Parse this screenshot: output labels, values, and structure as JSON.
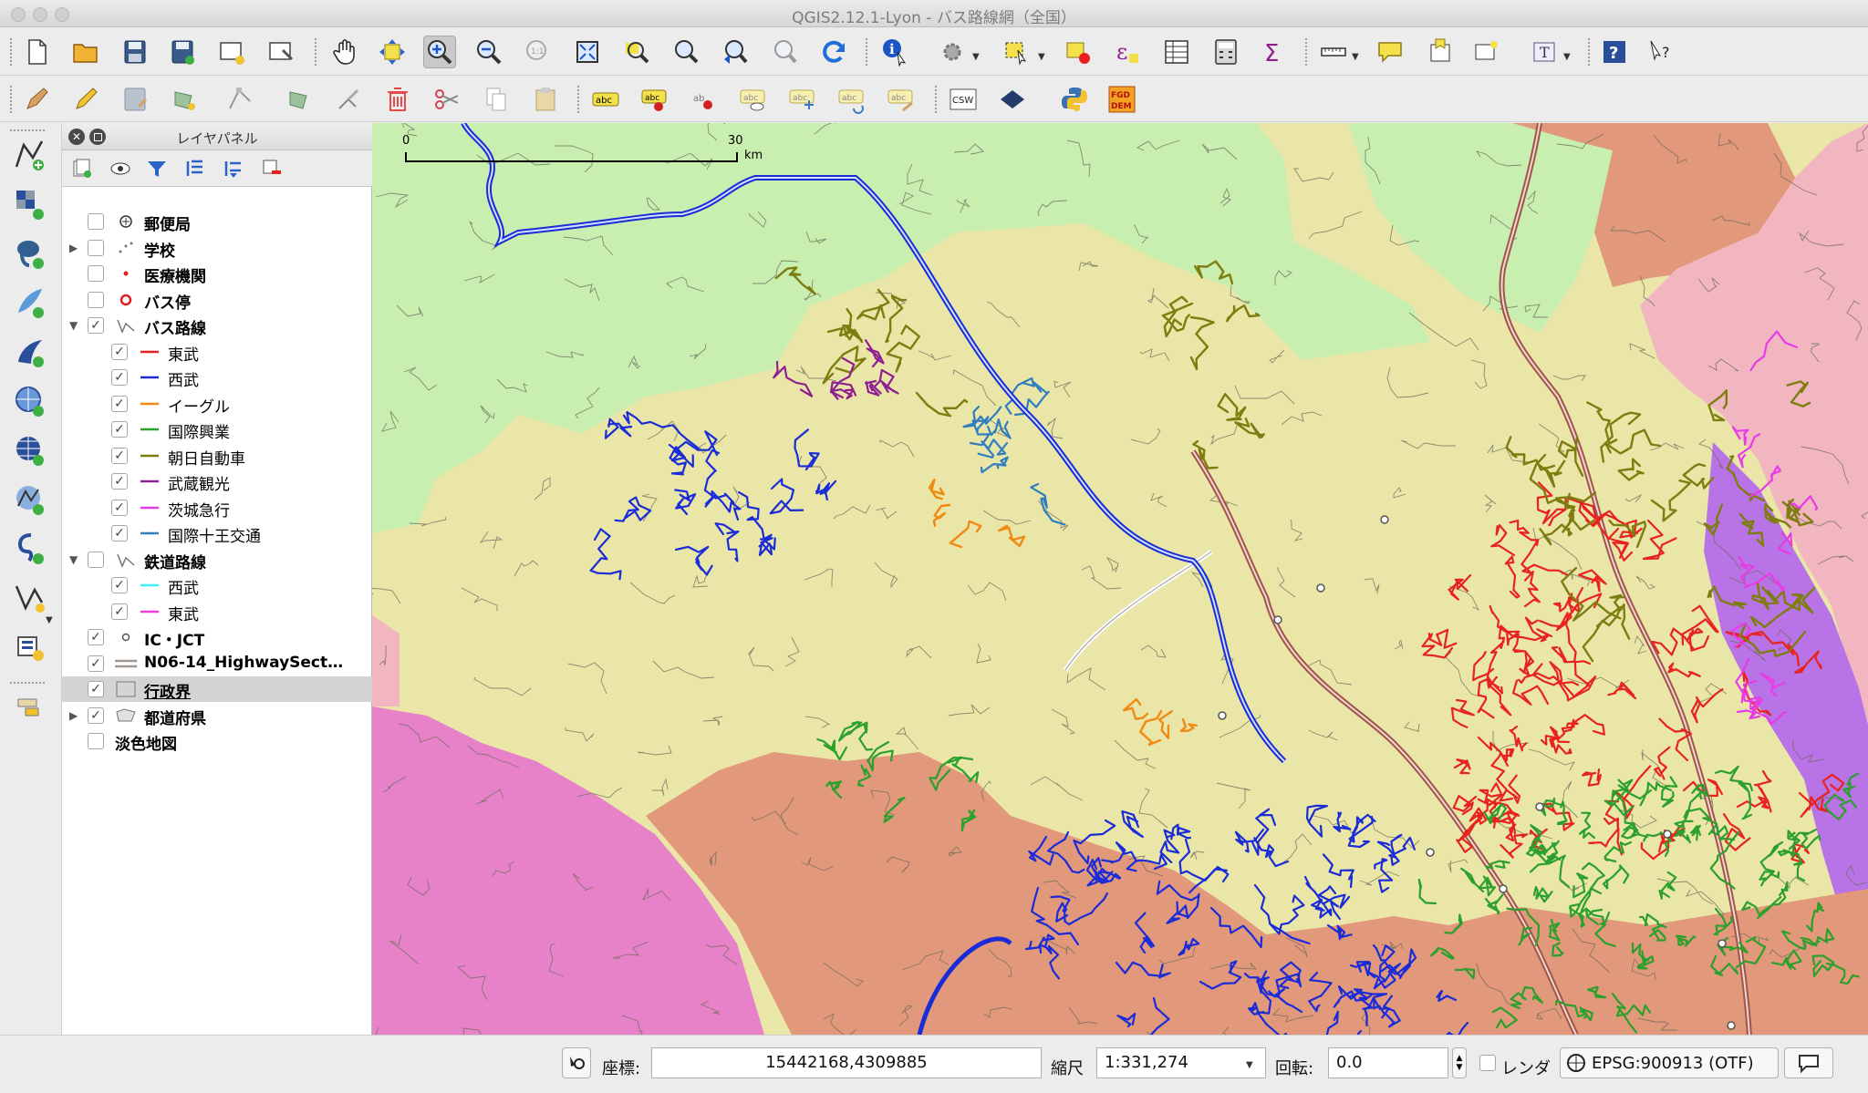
{
  "window": {
    "title": "QGIS2.12.1-Lyon - バス路線網（全国）"
  },
  "toolbar1": {
    "icons": [
      "new-project-icon",
      "open-project-icon",
      "save-project-icon",
      "save-as-icon",
      "new-print-composer-icon",
      "composer-manager-icon",
      "pan-icon",
      "pan-to-selection-icon",
      "zoom-in-icon",
      "zoom-out-icon",
      "zoom-actual-icon",
      "zoom-full-icon",
      "zoom-to-selection-icon",
      "zoom-to-layer-icon",
      "zoom-last-icon",
      "zoom-next-icon",
      "refresh-icon",
      "identify-icon",
      "action-icon",
      "select-icon",
      "deselect-icon",
      "expression-select-icon",
      "attribute-table-icon",
      "field-calculator-icon",
      "statistics-icon",
      "measure-icon",
      "map-tips-icon",
      "bookmark-icon",
      "annotation-icon",
      "text-annotation-icon",
      "help-icon",
      "whats-this-icon"
    ]
  },
  "toolbar2": {
    "icons": [
      "current-edits-icon",
      "toggle-editing-icon",
      "save-edits-icon",
      "add-feature-icon",
      "node-tool-icon",
      "move-feature-icon",
      "modify-attributes-icon",
      "delete-selected-icon",
      "cut-features-icon",
      "copy-features-icon",
      "paste-features-icon",
      "label-tool-icon",
      "pin-labels-icon",
      "highlight-pinned-icon",
      "show-hide-labels-icon",
      "move-label-icon",
      "rotate-label-icon",
      "change-label-icon",
      "csw-icon",
      "metasearch-icon",
      "python-console-icon",
      "fgd-icon"
    ],
    "csw_label": "CSW",
    "abc_label": "abc",
    "fgd_label": "FGD DEM"
  },
  "leftToolbar": {
    "icons": [
      "add-vector-layer-icon",
      "add-raster-layer-icon",
      "add-postgis-layer-icon",
      "add-spatialite-layer-icon",
      "add-mssql-layer-icon",
      "add-wms-layer-icon",
      "add-wcs-layer-icon",
      "add-wfs-layer-icon",
      "add-delimited-text-icon",
      "new-shapefile-icon",
      "new-spatialite-icon",
      "add-oracle-layer-icon"
    ]
  },
  "layerPanel": {
    "title": "レイヤパネル",
    "tools": [
      "add-group-icon",
      "manage-visibility-icon",
      "filter-legend-icon",
      "expand-all-icon",
      "collapse-all-icon",
      "remove-layer-icon"
    ],
    "layers": [
      {
        "label": "郵便局",
        "checked": false,
        "bold": true,
        "level": 0,
        "expander": "",
        "symbol": "postoffice"
      },
      {
        "label": "学校",
        "checked": false,
        "bold": true,
        "level": 0,
        "expander": "▶",
        "symbol": "school"
      },
      {
        "label": "医療機関",
        "checked": false,
        "bold": true,
        "level": 0,
        "expander": "",
        "symbol": "dot-red"
      },
      {
        "label": "バス停",
        "checked": false,
        "bold": true,
        "level": 0,
        "expander": "",
        "symbol": "ring-red"
      },
      {
        "label": "バス路線",
        "checked": true,
        "bold": true,
        "level": 0,
        "expander": "▼",
        "symbol": "line-gray"
      },
      {
        "label": "東武",
        "checked": true,
        "bold": false,
        "level": 1,
        "expander": "",
        "symbol": "line",
        "color": "#e8231f"
      },
      {
        "label": "西武",
        "checked": true,
        "bold": false,
        "level": 1,
        "expander": "",
        "symbol": "line",
        "color": "#1a2bd8"
      },
      {
        "label": "イーグル",
        "checked": true,
        "bold": false,
        "level": 1,
        "expander": "",
        "symbol": "line",
        "color": "#f08a12"
      },
      {
        "label": "国際興業",
        "checked": true,
        "bold": false,
        "level": 1,
        "expander": "",
        "symbol": "line",
        "color": "#2ca02c"
      },
      {
        "label": "朝日自動車",
        "checked": true,
        "bold": false,
        "level": 1,
        "expander": "",
        "symbol": "line",
        "color": "#7d7d10"
      },
      {
        "label": "武蔵観光",
        "checked": true,
        "bold": false,
        "level": 1,
        "expander": "",
        "symbol": "line",
        "color": "#8e1f8e"
      },
      {
        "label": "茨城急行",
        "checked": true,
        "bold": false,
        "level": 1,
        "expander": "",
        "symbol": "line",
        "color": "#e83be8"
      },
      {
        "label": "国際十王交通",
        "checked": true,
        "bold": false,
        "level": 1,
        "expander": "",
        "symbol": "line",
        "color": "#2f7fbf"
      },
      {
        "label": "鉄道路線",
        "checked": false,
        "bold": true,
        "level": 0,
        "expander": "▼",
        "symbol": "line-gray"
      },
      {
        "label": "西武",
        "checked": true,
        "bold": false,
        "level": 1,
        "expander": "",
        "symbol": "line",
        "color": "#3ff0ff"
      },
      {
        "label": "東武",
        "checked": true,
        "bold": false,
        "level": 1,
        "expander": "",
        "symbol": "line",
        "color": "#f03cd8"
      },
      {
        "label": "IC・JCT",
        "checked": true,
        "bold": true,
        "level": 0,
        "expander": "",
        "symbol": "ring-gray"
      },
      {
        "label": "N06-14_HighwaySect…",
        "checked": true,
        "bold": true,
        "level": 0,
        "expander": "",
        "symbol": "double-line"
      },
      {
        "label": "行政界",
        "checked": true,
        "bold": true,
        "level": 0,
        "expander": "",
        "symbol": "box",
        "selected": true,
        "underline": true
      },
      {
        "label": "都道府県",
        "checked": true,
        "bold": true,
        "level": 0,
        "expander": "▶",
        "symbol": "polygon"
      },
      {
        "label": "淡色地図",
        "checked": false,
        "bold": true,
        "level": 0,
        "expander": "",
        "symbol": "none"
      }
    ]
  },
  "map": {
    "scalebar": {
      "start": "0",
      "end": "30",
      "unit": "km"
    },
    "colors": {
      "boundary": "#6a6a5a",
      "saitama": "#eae6a8",
      "tokyo": "#e2987a",
      "gunma": "#c8eeb0",
      "yamanashi": "#e882c8",
      "ibaraki": "#f2b6c0",
      "chiba": "#b873e6",
      "tobu": "#e8231f",
      "seibu": "#1a2bd8",
      "eagle": "#f08a12",
      "kokusai": "#2ca02c",
      "asahi": "#7d7d10",
      "musashi": "#8e1f8e",
      "ibaraki_kyuko": "#e83be8",
      "juo": "#2f7fbf",
      "highway": "#a0544a"
    }
  },
  "statusbar": {
    "coord_label": "座標:",
    "coord_value": "15442168,4309885",
    "scale_label": "縮尺",
    "scale_value": "1:331,274",
    "rotation_label": "回転:",
    "rotation_value": "0.0",
    "render_label": "レンダ",
    "crs_value": "EPSG:900913 (OTF)"
  }
}
